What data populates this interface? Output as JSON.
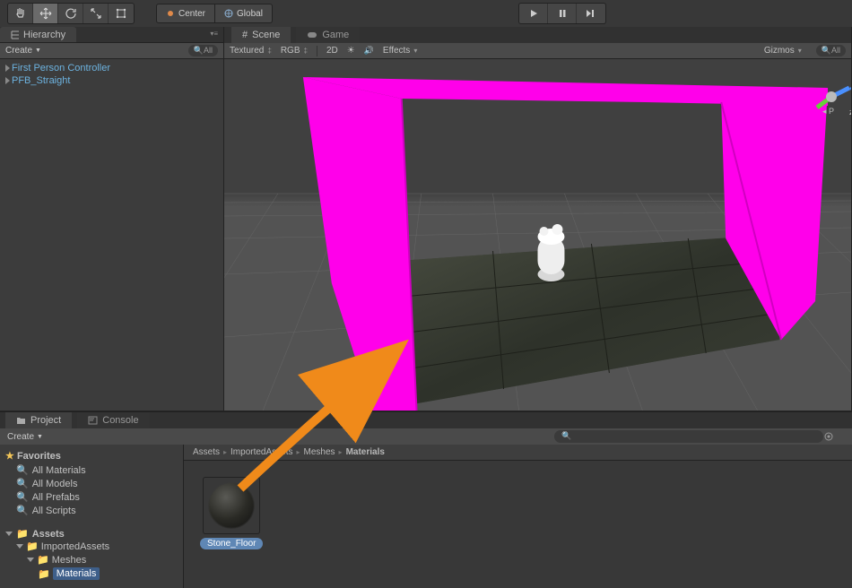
{
  "toolbar": {
    "pivot_center": "Center",
    "pivot_global": "Global"
  },
  "hierarchy": {
    "tab": "Hierarchy",
    "create": "Create",
    "search_placeholder": "All",
    "items": [
      "First Person Controller",
      "PFB_Straight"
    ]
  },
  "scene": {
    "tab_scene": "Scene",
    "tab_game": "Game",
    "shading": "Textured",
    "colormode": "RGB",
    "twoD": "2D",
    "effects": "Effects",
    "gizmos": "Gizmos",
    "search_placeholder": "All",
    "axis_label": "P"
  },
  "project": {
    "tab_project": "Project",
    "tab_console": "Console",
    "create": "Create",
    "favorites_label": "Favorites",
    "favorites": [
      "All Materials",
      "All Models",
      "All Prefabs",
      "All Scripts"
    ],
    "assets_root": "Assets",
    "tree": {
      "root": "Assets",
      "l1": "ImportedAssets",
      "l2": "Meshes",
      "l3": "Materials"
    },
    "breadcrumb": [
      "Assets",
      "ImportedAssets",
      "Meshes",
      "Materials"
    ],
    "asset": {
      "name": "Stone_Floor"
    }
  }
}
